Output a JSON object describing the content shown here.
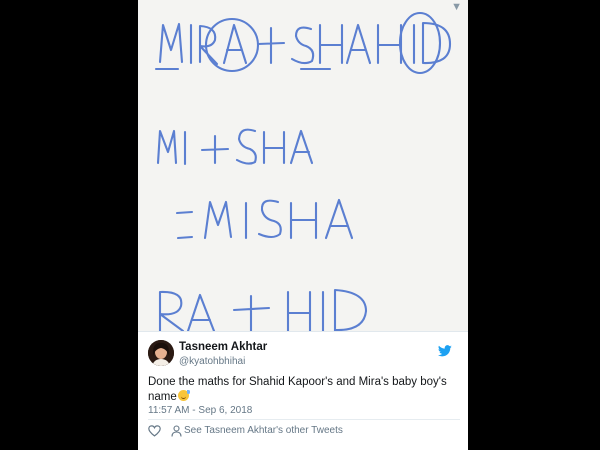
{
  "tweet": {
    "menu_icon": "chevron-down-icon",
    "image": {
      "icon": "handwritten-note-image",
      "lines": [
        "MIRA+SHAHID",
        "MI+SHA",
        "=MISHA",
        "RA+HID"
      ]
    },
    "author": {
      "name": "Tasneem Akhtar",
      "handle": "@kyatohbhihai",
      "avatar_icon": "avatar-photo"
    },
    "brand_icon": "twitter-bird-icon",
    "text": "Done the maths for Shahid Kapoor's and Mira's baby boy's name",
    "emoji_icon": "grinning-sweat-emoji",
    "timestamp": "11:57 AM - Sep 6, 2018",
    "actions": {
      "like_icon": "heart-icon",
      "profile_icon": "profile-icon",
      "other_tweets": "See Tasneem Akhtar's other Tweets"
    },
    "colors": {
      "ink": "#5b7fd1",
      "twitter_blue": "#1da1f2",
      "text_dark": "#14171a",
      "text_muted": "#657786"
    }
  }
}
